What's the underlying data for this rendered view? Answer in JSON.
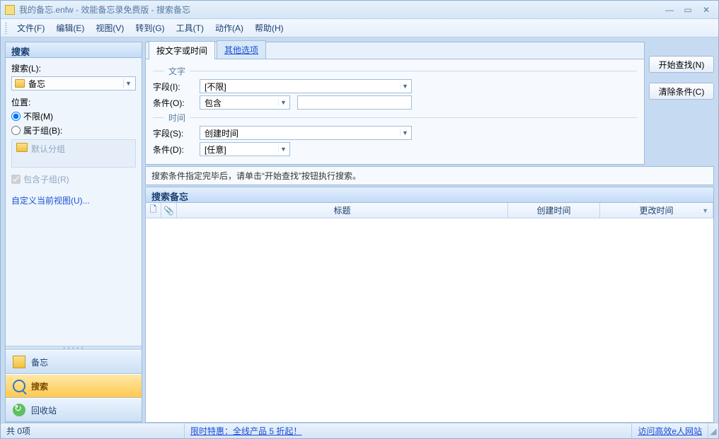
{
  "title": "我的备忘.enfw - 效能备忘录免费版 - 搜索备忘",
  "menu": [
    "文件(F)",
    "编辑(E)",
    "视图(V)",
    "转到(G)",
    "工具(T)",
    "动作(A)",
    "帮助(H)"
  ],
  "left": {
    "header": "搜索",
    "search_label": "搜索(L):",
    "search_value": "备忘",
    "location_label": "位置:",
    "radio_unlimited": "不限(M)",
    "radio_group": "属于组(B):",
    "group_placeholder": "默认分组",
    "include_subgroups": "包含子组(R)",
    "customize_view": "自定义当前视图(U)...",
    "nav": {
      "memo": "备忘",
      "search": "搜索",
      "recycle": "回收站"
    }
  },
  "tabs": {
    "text_time": "按文字或时间",
    "other": "其他选项"
  },
  "sections": {
    "text": "文字",
    "time": "时间"
  },
  "form": {
    "field_i_label": "字段(I):",
    "field_i_value": "[不限]",
    "cond_o_label": "条件(O):",
    "cond_o_value": "包含",
    "cond_o_input": "",
    "field_s_label": "字段(S):",
    "field_s_value": "创建时间",
    "cond_d_label": "条件(D):",
    "cond_d_value": "[任意]"
  },
  "buttons": {
    "find": "开始查找(N)",
    "clear": "清除条件(C)"
  },
  "hint": "搜索条件指定完毕后，请单击“开始查找”按钮执行搜索。",
  "results": {
    "header": "搜索备忘",
    "cols": {
      "title": "标题",
      "created": "创建时间",
      "modified": "更改时间"
    }
  },
  "status": {
    "count": "共 0项",
    "promo": "限时特惠：全线产品 5 折起！",
    "site": "访问高效e人网站"
  }
}
